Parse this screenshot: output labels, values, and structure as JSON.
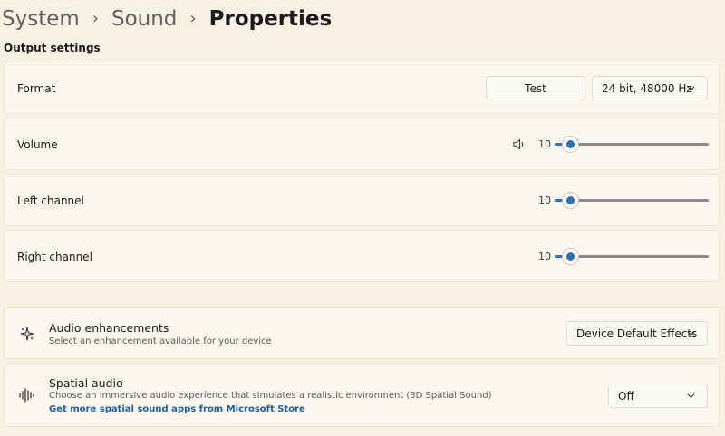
{
  "breadcrumb": {
    "items": [
      "System",
      "Sound"
    ],
    "current": "Properties",
    "separator": "›"
  },
  "output_settings": {
    "title": "Output settings",
    "format": {
      "label": "Format",
      "test_button": "Test",
      "selected": "24 bit, 48000 Hz"
    },
    "volume": {
      "label": "Volume",
      "value": "10",
      "level": 10
    },
    "left_channel": {
      "label": "Left channel",
      "value": "10",
      "level": 10
    },
    "right_channel": {
      "label": "Right channel",
      "value": "10",
      "level": 10
    }
  },
  "audio_enhancements": {
    "title": "Audio enhancements",
    "description": "Select an enhancement available for your device",
    "selected": "Device Default Effects"
  },
  "spatial_audio": {
    "title": "Spatial audio",
    "description": "Choose an immersive audio experience that simulates a realistic environment (3D Spatial Sound)",
    "link": "Get more spatial sound apps from Microsoft Store",
    "selected": "Off"
  },
  "icons": {
    "speaker": "speaker-icon",
    "enhancements": "sparkle-icon",
    "spatial": "waveform-icon",
    "chevron": "chevron-down-icon"
  },
  "colors": {
    "accent": "#2f6fb6",
    "link": "#1f5fa8",
    "background": "#f7f1e3",
    "card": "#fbf7ee"
  }
}
